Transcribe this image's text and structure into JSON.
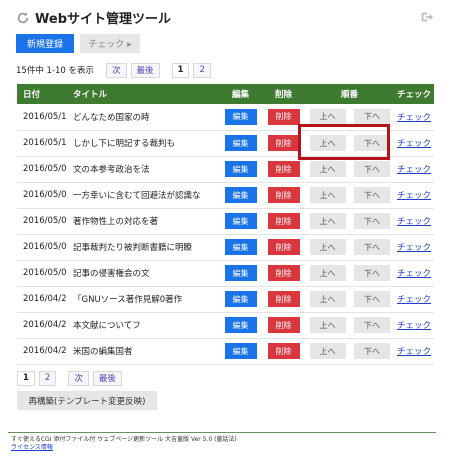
{
  "header": {
    "title": "Webサイト管理ツール",
    "refresh_icon": "refresh-icon",
    "exit_icon": "exit-icon"
  },
  "toolbar": {
    "new_label": "新規登録",
    "check_label": "チェック ▸"
  },
  "pagination_top": {
    "summary": "15件中 1-10 を表示",
    "next": "次",
    "last": "最後",
    "pages": [
      "1",
      "2"
    ],
    "current_page": "1"
  },
  "table": {
    "headers": {
      "date": "日付",
      "title": "タイトル",
      "edit": "編集",
      "delete": "削除",
      "order": "順番",
      "check": "チェック"
    },
    "button_labels": {
      "edit": "編集",
      "delete": "削除",
      "up": "上へ",
      "down": "下へ",
      "check": "チェック"
    },
    "rows": [
      {
        "date": "2016/05/13",
        "title": "どんなため国家の時"
      },
      {
        "date": "2016/05/11",
        "title": "しかし下に明記する裁判も"
      },
      {
        "date": "2016/05/09",
        "title": "文の本参考政治を法"
      },
      {
        "date": "2016/05/07",
        "title": "一方幸いに含むて回避法が認識な"
      },
      {
        "date": "2016/05/05",
        "title": "著作物性上の対応を著"
      },
      {
        "date": "2016/05/03",
        "title": "記事裁判たり被判断書籍に明瞭"
      },
      {
        "date": "2016/05/01",
        "title": "記事の侵害権会の文"
      },
      {
        "date": "2016/04/29",
        "title": "「GNUソース著作見解0著作"
      },
      {
        "date": "2016/04/27",
        "title": "本文献についてフ"
      },
      {
        "date": "2016/04/25",
        "title": "米国の編集国者"
      }
    ]
  },
  "pagination_bottom": {
    "pages": [
      "1",
      "2"
    ],
    "current_page": "1",
    "next": "次",
    "last": "最後"
  },
  "rebuild_label": "再構築(テンプレート変更反映)",
  "footer": {
    "line1": "すぐ使えるCGI 添付ファイル付 ウェブページ更新ツール 大吉童版 Ver 5.0 (童話法)",
    "license_link": "ライセンス情報"
  },
  "colors": {
    "table_header": "#3f7a31",
    "edit_button": "#1a73e8",
    "delete_button": "#d9363e",
    "highlight_border": "#b5131a"
  }
}
